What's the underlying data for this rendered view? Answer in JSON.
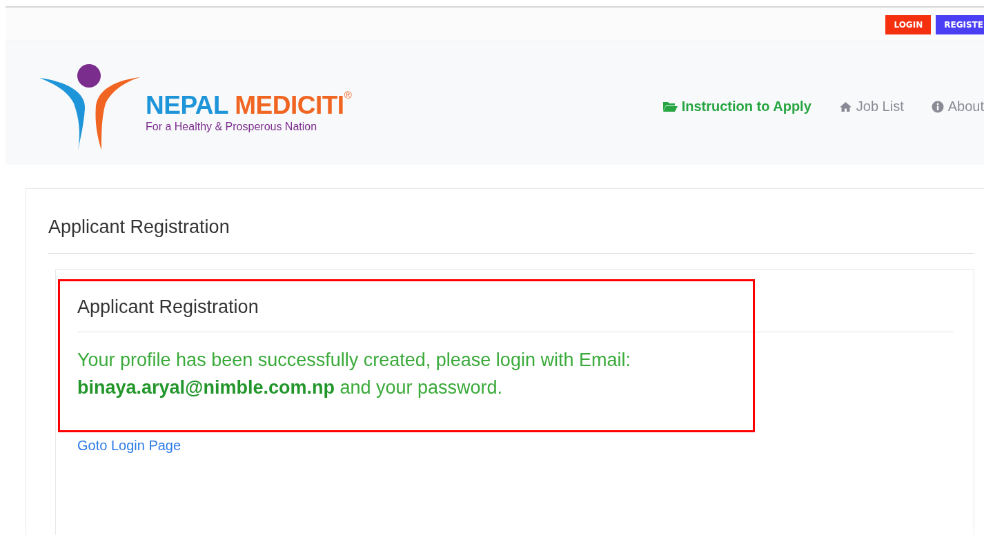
{
  "top_bar": {
    "buttons": [
      {
        "label": "LOGIN",
        "kind": "login"
      },
      {
        "label": "REGISTE",
        "kind": "register"
      }
    ]
  },
  "header": {
    "logo": {
      "word_1": "NEPAL",
      "word_2": "MEDICITI",
      "mark": "®",
      "tagline": "For a Healthy & Prosperous Nation"
    },
    "nav": [
      {
        "label": "Instruction to Apply",
        "kind": "folder",
        "selected": true
      },
      {
        "label": "Job List",
        "kind": "home",
        "selected": false
      },
      {
        "label": "About",
        "kind": "info",
        "selected": false
      }
    ]
  },
  "card": {
    "title": "Applicant Registration",
    "panel": {
      "title": "Applicant Registration",
      "message": "Your profile has been successfully created, please login with Email: **binaya.aryal@nimble.com.np** and your password.",
      "link": "Goto Login Page"
    }
  }
}
